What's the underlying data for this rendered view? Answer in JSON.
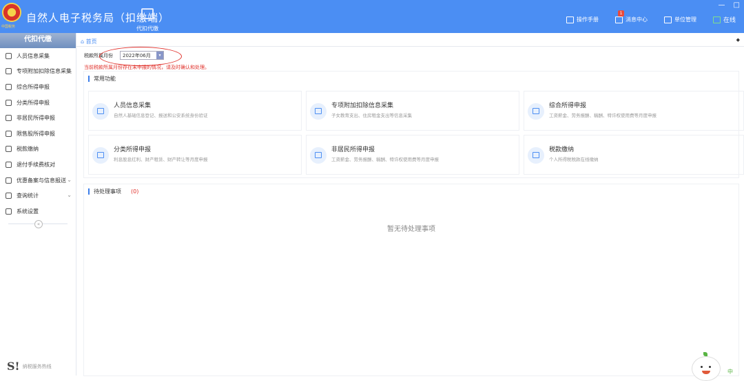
{
  "window": {
    "controls": [
      "—",
      "□"
    ]
  },
  "header": {
    "title": "自然人电子税务局（扣缴端）",
    "logo_text": "中国税务",
    "tab_label": "代扣代缴",
    "actions": [
      {
        "label": "操作手册",
        "icon": "manual-icon"
      },
      {
        "label": "消息中心",
        "icon": "mail-icon",
        "badge": "1"
      },
      {
        "label": "单位管理",
        "icon": "building-icon"
      },
      {
        "label": "在线",
        "icon": "monitor-icon"
      }
    ]
  },
  "sidebar": {
    "header": "代扣代缴",
    "items": [
      {
        "label": "人员信息采集",
        "icon": "person-icon"
      },
      {
        "label": "专项附加扣除信息采集",
        "icon": "list-icon"
      },
      {
        "label": "综合所得申报",
        "icon": "layers-icon"
      },
      {
        "label": "分类所得申报",
        "icon": "pie-icon"
      },
      {
        "label": "非居民所得申报",
        "icon": "user-icon"
      },
      {
        "label": "限售股所得申报",
        "icon": "bar-chart-icon"
      },
      {
        "label": "税款缴纳",
        "icon": "folder-icon"
      },
      {
        "label": "退付手续费核对",
        "icon": "doc-icon"
      },
      {
        "label": "优惠备案与信息报送",
        "icon": "file-icon",
        "chevron": "⌄"
      },
      {
        "label": "查询统计",
        "icon": "search-doc-icon",
        "chevron": "⌄"
      },
      {
        "label": "系统设置",
        "icon": "gear-icon"
      }
    ],
    "collapse": "«",
    "hotline": {
      "mark": "S!",
      "label": "纳税服务热线"
    }
  },
  "breadcrumb": {
    "home": "首页",
    "close": "◆"
  },
  "period": {
    "label": "税款所属月份",
    "value": "2022年06月",
    "dropdown": "▾"
  },
  "warning": "当前税款所属月份存在未申报的情况，请及时确认和处理。",
  "common": {
    "title": "常用功能",
    "cards": [
      {
        "title": "人员信息采集",
        "desc": "自然人基础信息登记、报送和公安系统身份验证"
      },
      {
        "title": "专项附加扣除信息采集",
        "desc": "子女教育支出、住房租金支出等信息采集"
      },
      {
        "title": "综合所得申报",
        "desc": "工资薪金、劳务报酬、稿酬、特许权使用费等月度申报"
      },
      {
        "title": "分类所得申报",
        "desc": "利息股息红利、财产租赁、财产转让等月度申报"
      },
      {
        "title": "非居民所得申报",
        "desc": "工资薪金、劳务报酬、稿酬、特许权使用费等月度申报"
      },
      {
        "title": "税款缴纳",
        "desc": "个人所得税税款在线缴纳"
      }
    ]
  },
  "pending": {
    "title": "待处理事项",
    "count": "(0)",
    "empty": "暂无待处理事项"
  },
  "corner_text": "中"
}
